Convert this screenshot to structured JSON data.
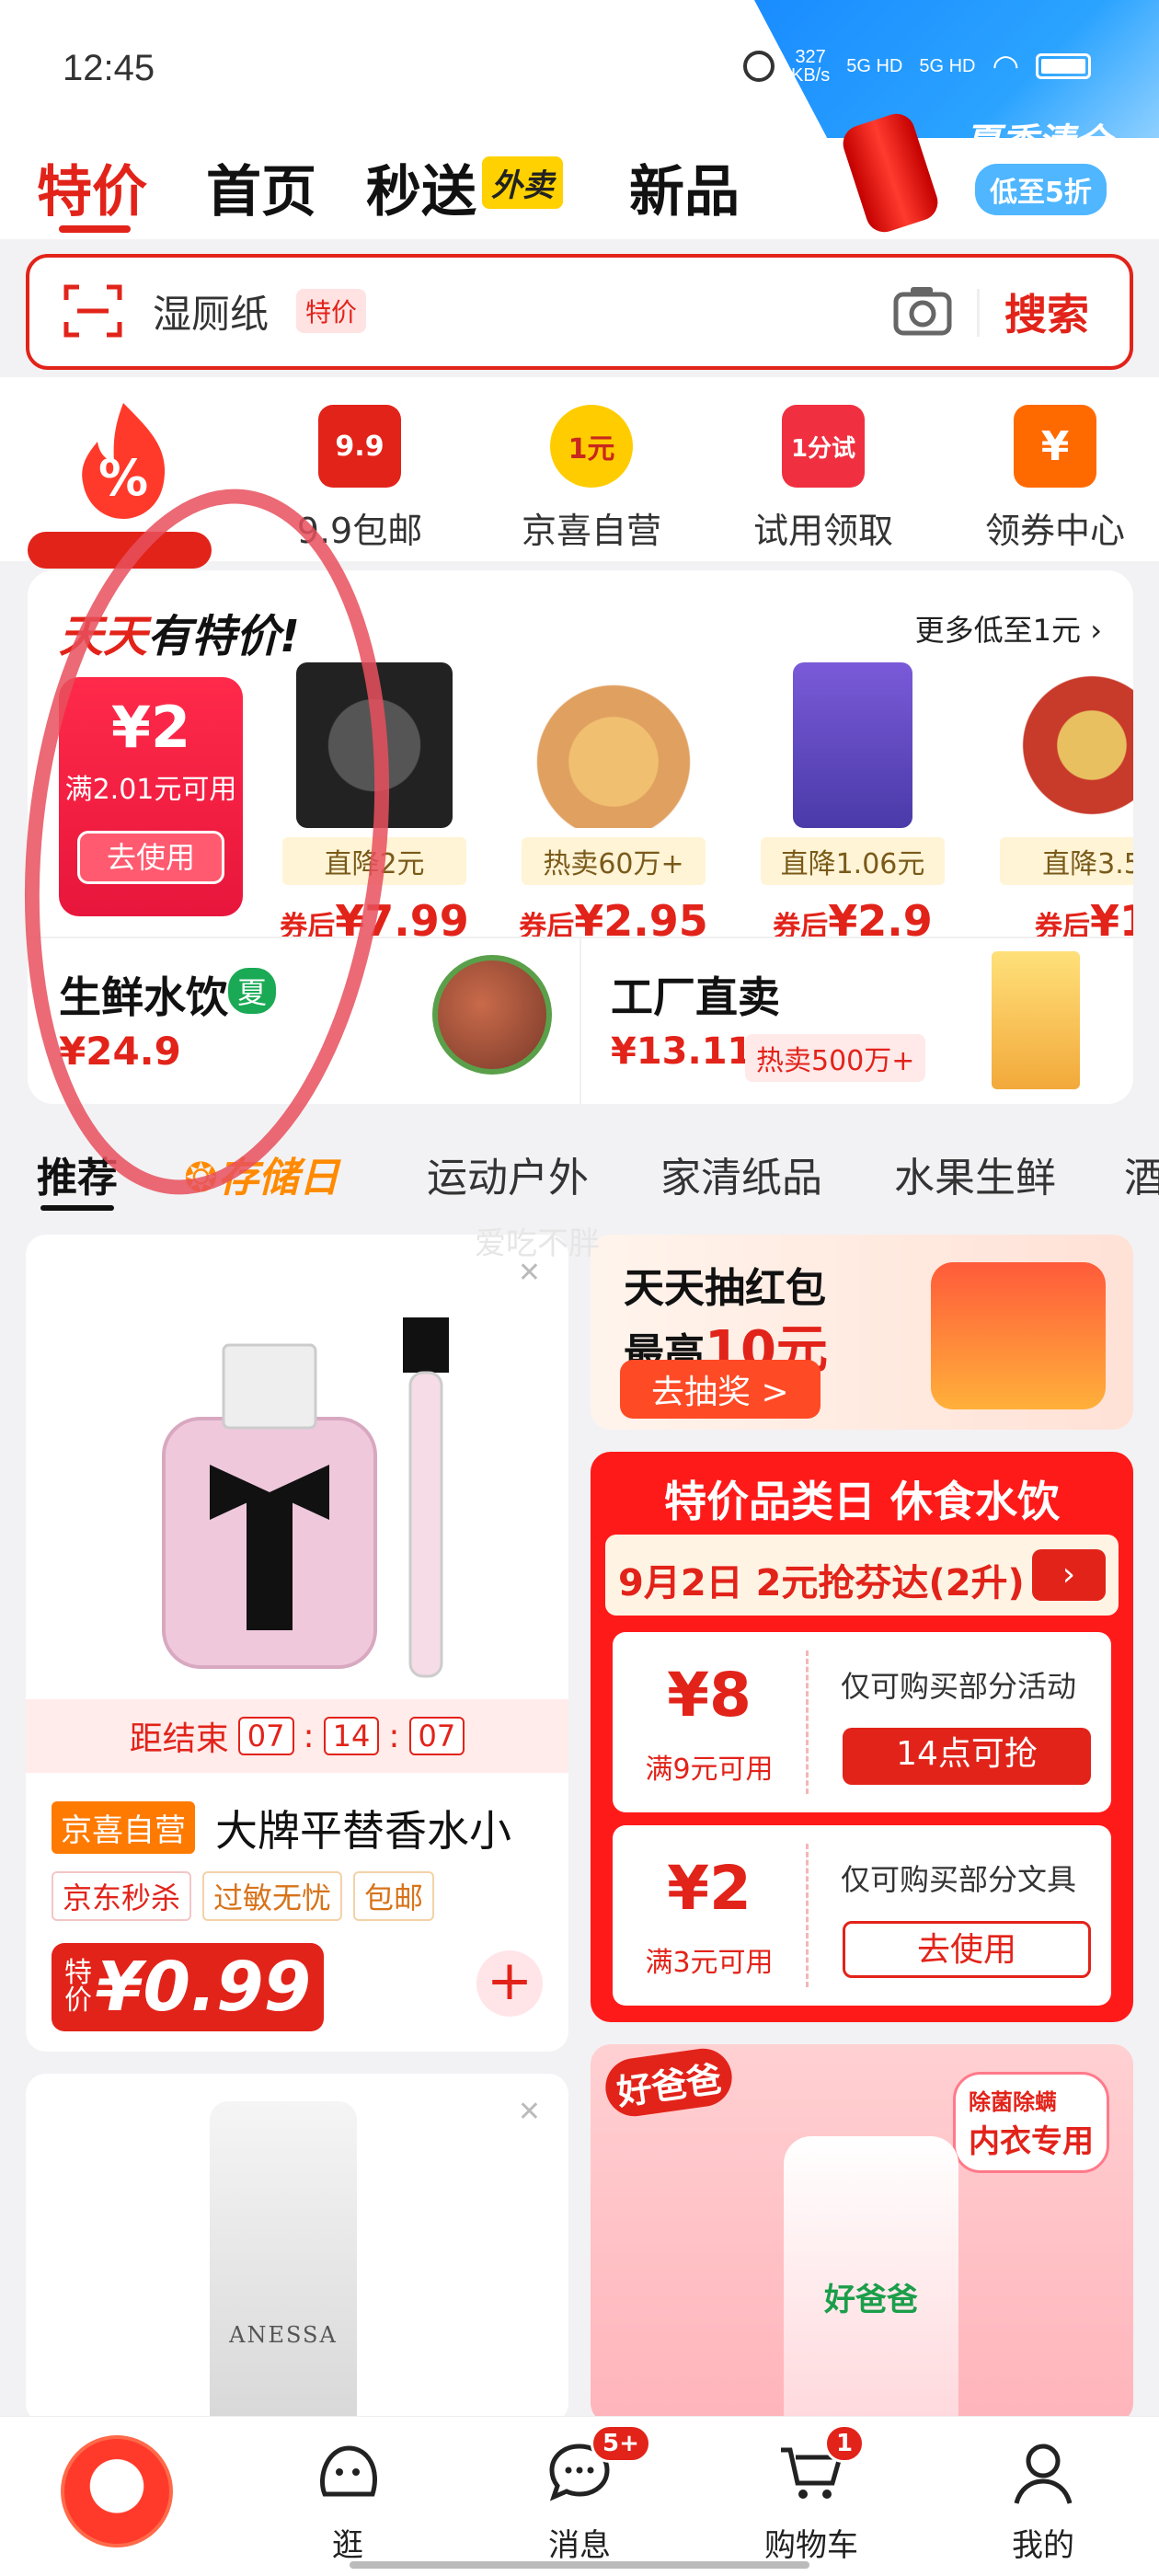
{
  "status_bar": {
    "time": "12:45",
    "net_speed": "327",
    "net_unit": "KB/s",
    "sim1": "5G HD",
    "sim2": "5G HD"
  },
  "top_tabs": {
    "active": "特价",
    "home": "首页",
    "flash": "秒送",
    "flash_badge": "外卖",
    "new": "新品"
  },
  "promo": {
    "title": "夏季清仓",
    "subtitle": "低至5折"
  },
  "search": {
    "query": "湿厕纸",
    "tag": "特价",
    "button": "搜索"
  },
  "categories": [
    {
      "label": "9.9包邮",
      "icon": "9.9",
      "color": "#e2231a"
    },
    {
      "label": "京喜自营",
      "icon": "1元",
      "color": "#ffcc00"
    },
    {
      "label": "试用领取",
      "icon": "1分试",
      "color": "#f03040"
    },
    {
      "label": "领券中心",
      "icon": "¥",
      "color": "#ff6a00"
    }
  ],
  "daily": {
    "title_red": "天天",
    "title_black": "有特价!",
    "more": "更多低至1元",
    "coupon": {
      "amount": "¥2",
      "condition": "满2.01元可用",
      "button": "去使用"
    },
    "items": [
      {
        "tag": "直降2元",
        "prefix": "券后",
        "price": "¥7.99",
        "color": "#222"
      },
      {
        "tag": "热卖60万+",
        "prefix": "券后",
        "price": "¥2.95",
        "color": "#e8a45a"
      },
      {
        "tag": "直降1.06元",
        "prefix": "券后",
        "price": "¥2.9",
        "color": "#6a4fc8"
      },
      {
        "tag": "直降3.5",
        "prefix": "券后",
        "price": "¥1",
        "color": "#c8a430"
      }
    ],
    "fresh": {
      "title": "生鲜水饮",
      "badge": "夏",
      "price": "¥24.9"
    },
    "factory": {
      "title": "工厂直卖",
      "price": "¥13.11",
      "tag": "热卖500万+"
    }
  },
  "feed_tabs": {
    "recommend": "推荐",
    "save_day": "存储日",
    "sports": "运动户外",
    "cleaning": "家清纸品",
    "fruit": "水果生鲜",
    "more": "酒"
  },
  "watermark": "爱吃不胖",
  "product1": {
    "countdown_label": "距结束",
    "hh": "07",
    "mm": "14",
    "ss": "07",
    "badge": "京喜自营",
    "title": "大牌平替香水小",
    "tags": [
      "京东秒杀",
      "过敏无忧",
      "包邮"
    ],
    "price_label": "特价",
    "price": "¥0.99",
    "add": "+"
  },
  "product2": {
    "brand": "ANESSA"
  },
  "redpacket": {
    "title": "天天抽红包",
    "amount_prefix": "最高",
    "amount": "10元",
    "button": "去抽奖 >"
  },
  "category_day": {
    "title": "特价品类日 休食水饮",
    "banner": "9月2日 2元抢芬达(2升)",
    "vouchers": [
      {
        "amount": "¥8",
        "condition": "满9元可用",
        "desc": "仅可购买部分活动",
        "button": "14点可抢",
        "style": "fill"
      },
      {
        "amount": "¥2",
        "condition": "满3元可用",
        "desc": "仅可购买部分文具",
        "button": "去使用",
        "style": "line"
      }
    ]
  },
  "ad": {
    "logo": "好爸爸",
    "badge": "内衣专用",
    "badge_top": "除菌除螨",
    "brand": "好爸爸"
  },
  "bottom_nav": {
    "browse": "逛",
    "messages": "消息",
    "messages_badge": "5+",
    "cart": "购物车",
    "cart_badge": "1",
    "mine": "我的"
  }
}
